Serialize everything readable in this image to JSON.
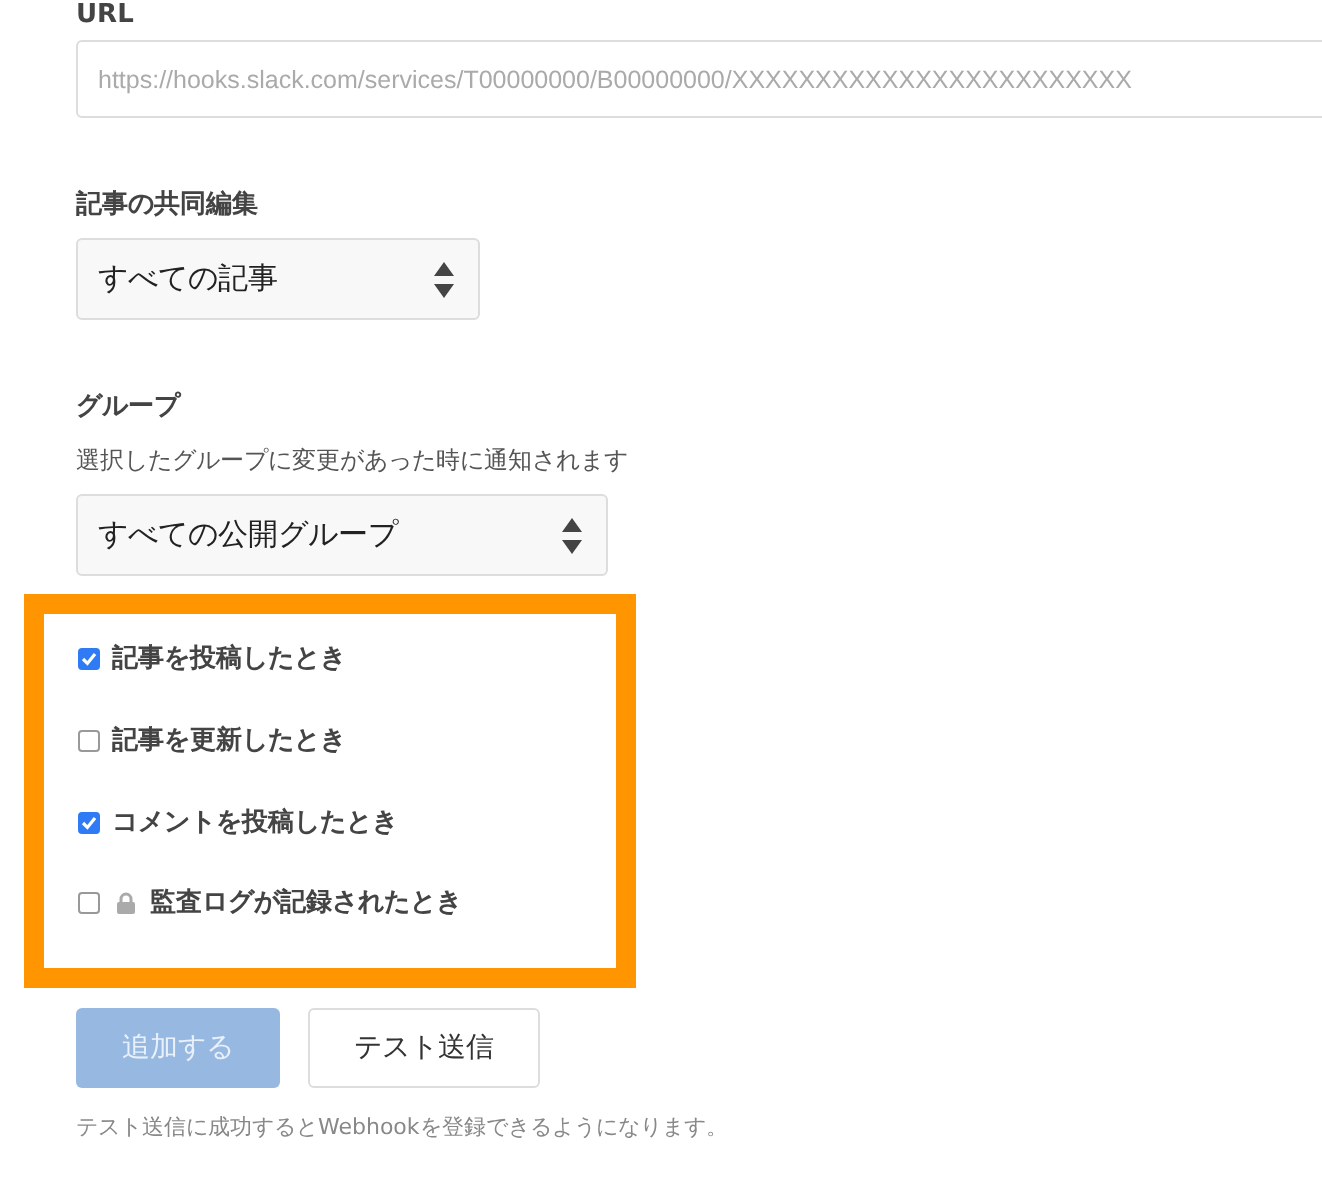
{
  "url_field": {
    "label": "URL",
    "placeholder": "https://hooks.slack.com/services/T00000000/B00000000/XXXXXXXXXXXXXXXXXXXXXXXX"
  },
  "coedit": {
    "label": "記事の共同編集",
    "value": "すべての記事"
  },
  "group": {
    "label": "グループ",
    "description": "選択したグループに変更があった時に通知されます",
    "value": "すべての公開グループ"
  },
  "events": [
    {
      "label": "記事を投稿したとき",
      "checked": true,
      "locked": false
    },
    {
      "label": "記事を更新したとき",
      "checked": false,
      "locked": false
    },
    {
      "label": "コメントを投稿したとき",
      "checked": true,
      "locked": false
    },
    {
      "label": "監査ログが記録されたとき",
      "checked": false,
      "locked": true
    }
  ],
  "buttons": [
    {
      "label": "追加する",
      "kind": "primary",
      "disabled": true
    },
    {
      "label": "テスト送信",
      "kind": "secondary",
      "disabled": false
    }
  ],
  "note": "テスト送信に成功するとWebhookを登録できるようになります。"
}
